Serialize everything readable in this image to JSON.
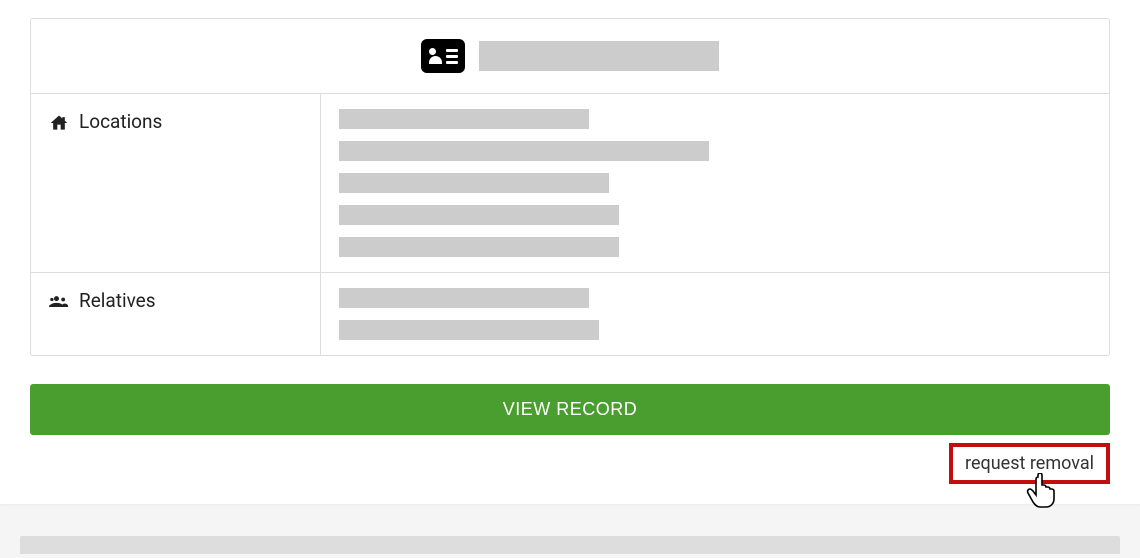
{
  "record": {
    "name_redacted": true,
    "sections": {
      "locations": {
        "label": "Locations",
        "items_widths": [
          250,
          370,
          270,
          280,
          280
        ]
      },
      "relatives": {
        "label": "Relatives",
        "items_widths": [
          250,
          260
        ]
      }
    }
  },
  "buttons": {
    "view_record": "VIEW RECORD",
    "request_removal": "request removal"
  }
}
